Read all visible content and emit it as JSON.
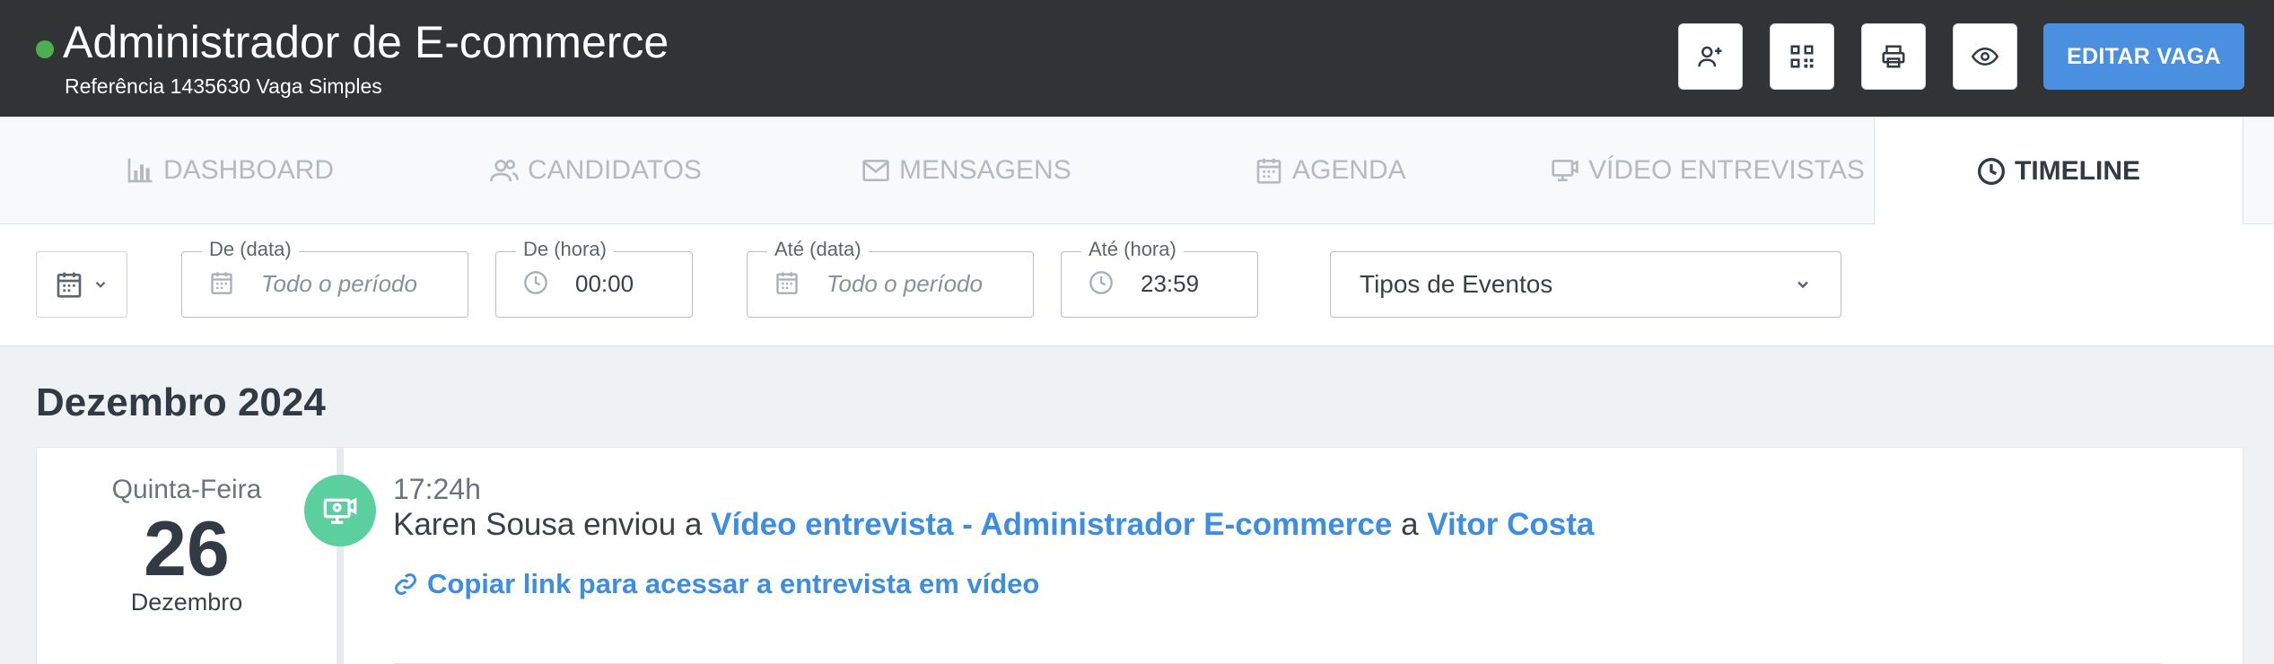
{
  "header": {
    "title": "Administrador de E-commerce",
    "subtitle": "Referência 1435630 Vaga Simples",
    "status_color": "#4caf50",
    "actions": [
      {
        "icon": "add-user-icon"
      },
      {
        "icon": "qr-code-icon"
      },
      {
        "icon": "print-icon"
      },
      {
        "icon": "eye-icon"
      }
    ],
    "edit_label": "EDITAR VAGA",
    "accent": "#4a8fe0"
  },
  "tabs": [
    {
      "label": "DASHBOARD",
      "icon": "bar-chart-icon"
    },
    {
      "label": "CANDIDATOS",
      "icon": "users-icon"
    },
    {
      "label": "MENSAGENS",
      "icon": "envelope-icon"
    },
    {
      "label": "AGENDA",
      "icon": "calendar-icon"
    },
    {
      "label": "VÍDEO ENTREVISTAS",
      "icon": "video-interview-icon"
    },
    {
      "label": "TIMELINE",
      "icon": "clock-icon",
      "active": true
    }
  ],
  "filters": {
    "from_date": {
      "label": "De (data)",
      "placeholder": "Todo o período"
    },
    "from_time": {
      "label": "De (hora)",
      "value": "00:00"
    },
    "to_date": {
      "label": "Até (data)",
      "placeholder": "Todo o período"
    },
    "to_time": {
      "label": "Até (hora)",
      "value": "23:59"
    },
    "event_types": "Tipos de Eventos"
  },
  "timeline": {
    "month": "Dezembro 2024",
    "entries": [
      {
        "weekday": "Quinta-Feira",
        "day": "26",
        "month": "Dezembro",
        "time": "17:24h",
        "actor": "Karen Sousa",
        "verb": " enviou a ",
        "link1": "Vídeo entrevista - Administrador E-commerce",
        "conj": " a ",
        "link2": "Vitor Costa",
        "action_link": "Copiar link para acessar a entrevista em vídeo",
        "icon_color": "#5bcf9e"
      }
    ]
  }
}
